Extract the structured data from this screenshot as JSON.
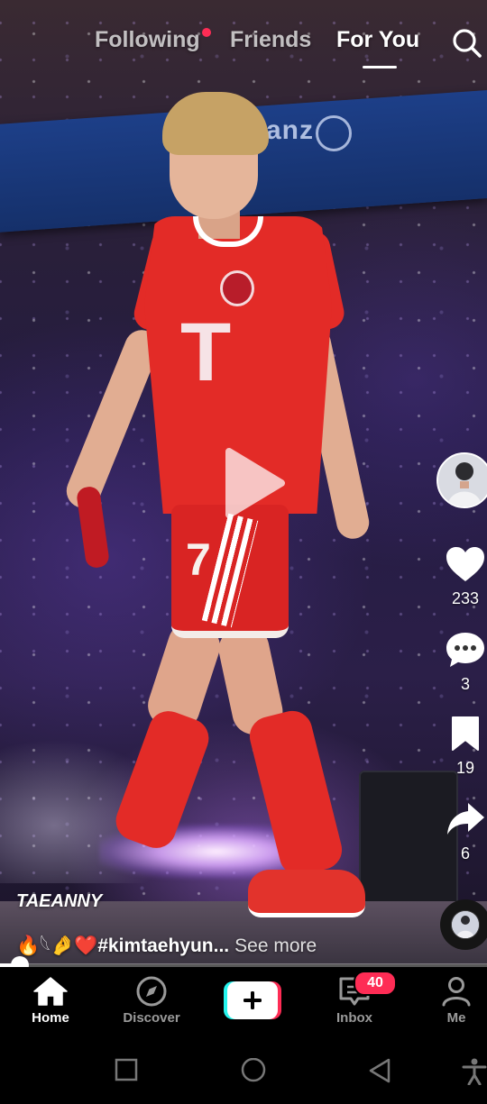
{
  "top_nav": {
    "tabs": [
      {
        "label": "Following",
        "has_dot": true
      },
      {
        "label": "Friends"
      },
      {
        "label": "For You",
        "active": true
      }
    ]
  },
  "icons": {
    "search": "search-icon",
    "play": "play-icon",
    "like": "heart-icon",
    "comment": "comment-icon",
    "save": "bookmark-icon",
    "share": "share-icon"
  },
  "actions": {
    "likes": "233",
    "comments": "3",
    "saves": "19",
    "shares": "6"
  },
  "video": {
    "username": "TAEANNY",
    "caption_emoji": "🔥𓆩🤌❤️",
    "caption_tags": "#kimtaehyun...",
    "see_more": "See more",
    "progress": 0.04,
    "jersey_logo": "T",
    "jersey_number": "7",
    "banner_text": "anz"
  },
  "bottom_nav": {
    "home": "Home",
    "discover": "Discover",
    "inbox": "Inbox",
    "inbox_badge": "40",
    "me": "Me"
  },
  "colors": {
    "accent": "#fe2c55",
    "cyan": "#25f4ee",
    "background": "#000000"
  }
}
